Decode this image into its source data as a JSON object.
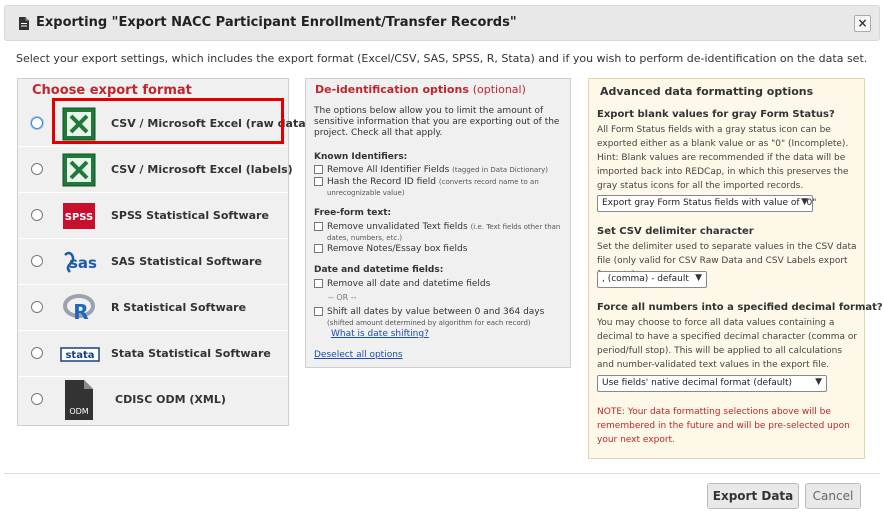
{
  "dialog": {
    "title": "Exporting \"Export NACC Participant Enrollment/Transfer Records\"",
    "close_label": "×",
    "intro": "Select your export settings, which includes the export format (Excel/CSV, SAS, SPSS, R, Stata) and if you wish to perform de-identification on the data set."
  },
  "formats": {
    "heading": "Choose export format",
    "items": [
      {
        "label": "CSV / Microsoft Excel (raw data)",
        "icon": "excel-icon"
      },
      {
        "label": "CSV / Microsoft Excel (labels)",
        "icon": "excel-icon"
      },
      {
        "label": "SPSS Statistical Software",
        "icon": "spss-icon",
        "icon_text": "SPSS"
      },
      {
        "label": "SAS Statistical Software",
        "icon": "sas-icon",
        "icon_text": "sas"
      },
      {
        "label": "R Statistical Software",
        "icon": "r-icon",
        "icon_text": "R"
      },
      {
        "label": "Stata Statistical Software",
        "icon": "stata-icon",
        "icon_text": "stata"
      },
      {
        "label": "CDISC ODM (XML)",
        "icon": "odm-icon",
        "icon_text": "ODM"
      }
    ]
  },
  "deid": {
    "heading": "De-identification options",
    "heading_optional": "(optional)",
    "description": "The options below allow you to limit the amount of sensitive information that you are exporting out of the project. Check all that apply.",
    "known_heading": "Known Identifiers:",
    "opt_remove_identifiers": "Remove All Identifier Fields",
    "opt_remove_identifiers_hint": "(tagged in Data Dictionary)",
    "opt_hash_record": "Hash the Record ID field",
    "opt_hash_record_hint": "(converts record name to an unrecognizable value)",
    "freeform_heading": "Free-form text:",
    "opt_remove_unvalidated": "Remove unvalidated Text fields",
    "opt_remove_unvalidated_hint": "(i.e. Text fields other than dates, numbers, etc.)",
    "opt_remove_notes": "Remove Notes/Essay box fields",
    "date_heading": "Date and datetime fields:",
    "opt_remove_dates": "Remove all date and datetime fields",
    "or_text": "-- OR --",
    "opt_shift_dates": "Shift all dates by value between 0 and 364 days",
    "opt_shift_dates_hint": "(shifted amount determined by algorithm for each record)",
    "what_is_link": "What is date shifting?",
    "deselect_link": "Deselect all options"
  },
  "advanced": {
    "heading": "Advanced data formatting options",
    "blank_heading": "Export blank values for gray Form Status?",
    "blank_text": "All Form Status fields with a gray status icon can be exported either as a blank value or as \"0\" (Incomplete). Hint: Blank values are recommended if the data will be imported back into REDCap, in which this preserves the gray status icons for all the imported records.",
    "blank_select": "Export gray Form Status fields with value of \"0\"",
    "delim_heading": "Set CSV delimiter character",
    "delim_text": "Set the delimiter used to separate values in the CSV data file (only valid for CSV Raw Data and CSV Labels export formats):",
    "delim_select": ", (comma) - default",
    "decimal_heading": "Force all numbers into a specified decimal format?",
    "decimal_text": "You may choose to force all data values containing a decimal to have a specified decimal character (comma or period/full stop). This will be applied to all calculations and number-validated text values in the export file.",
    "decimal_select": "Use fields' native decimal format (default)",
    "note": "NOTE: Your data formatting selections above will be remembered in the future and will be pre-selected upon your next export."
  },
  "buttons": {
    "export": "Export Data",
    "cancel": "Cancel"
  }
}
